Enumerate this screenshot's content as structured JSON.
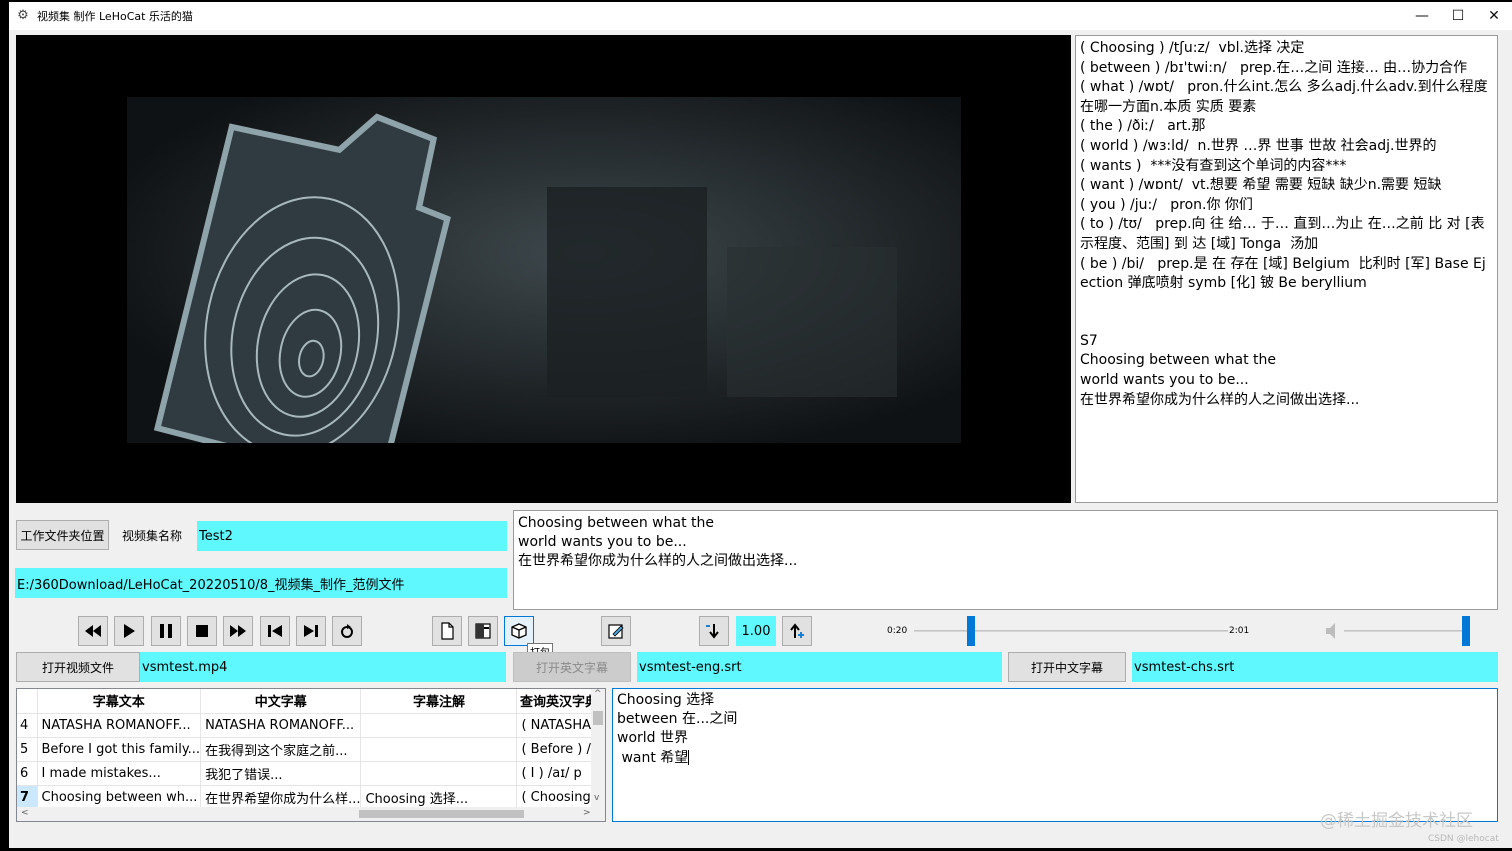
{
  "window": {
    "title": "视频集 制作  LeHoCat 乐活的猫",
    "minimize": "—",
    "maximize": "☐",
    "close": "✕"
  },
  "dictionary": {
    "lines": [
      "( Choosing ) /tʃu:z/  vbl.选择 决定",
      "( between ) /bɪ'twi:n/   prep.在…之间 连接… 由…协力合作",
      "( what ) /wɒt/   pron.什么int.怎么 多么adj.什么adv.到什么程度 在哪一方面n.本质 实质 要素",
      "( the ) /ðiː/   art.那",
      "( world ) /wɜ:ld/  n.世界 …界 世事 世故 社会adj.世界的",
      "( wants )  ***没有查到这个单词的内容***",
      "( want ) /wɒnt/  vt.想要 希望 需要 短缺 缺少n.需要 短缺",
      "( you ) /ju:/   pron.你 你们",
      "( to ) /tʊ/   prep.向 往 给… 于… 直到…为止 在…之前 比 对 [表示程度、范围] 到 达 [域] Tonga  汤加",
      "( be ) /bi/   prep.是 在 存在 [域] Belgium  比利时 [军] Base Ejection 弹底喷射 symb [化] 铍 Be beryllium"
    ],
    "entry_id": "S7",
    "entry_lines": [
      "Choosing between what the",
      "world wants you to be...",
      "在世界希望你成为什么样的人之间做出选择..."
    ]
  },
  "workspace": {
    "folder_button": "工作文件夹位置",
    "name_label": "视频集名称",
    "name_value": "Test2",
    "path_value": "E:/360Download/LeHoCat_20220510/8_视频集_制作_范例文件"
  },
  "current_subtitle": {
    "lines": [
      "Choosing between what the",
      "world wants you to be...",
      "在世界希望你成为什么样的人之间做出选择..."
    ]
  },
  "controls": {
    "speed": "1.00",
    "tooltip": "打包",
    "time_start": "0:20",
    "time_end": "2:01",
    "volume_level": 1.0,
    "position_fraction": 0.17
  },
  "files": {
    "open_video": "打开视频文件",
    "video_file": "vsmtest.mp4",
    "open_eng": "打开英文字幕",
    "eng_file": "vsmtest-eng.srt",
    "open_chs": "打开中文字幕",
    "chs_file": "vsmtest-chs.srt"
  },
  "table": {
    "headers": [
      "",
      "字幕文本",
      "中文字幕",
      "字幕注解",
      "查询英汉字典"
    ],
    "rows": [
      [
        "4",
        "NATASHA ROMANOFF...",
        "NATASHA ROMANOFF...",
        "",
        "( NATASHA"
      ],
      [
        "5",
        "Before I got this family...",
        "在我得到这个家庭之前...",
        "",
        "( Before ) /l"
      ],
      [
        "6",
        "I made mistakes...",
        "我犯了错误...",
        "",
        "( I ) /aɪ/  p"
      ],
      [
        "7",
        "Choosing between wh...",
        "在世界希望你成为什么样...",
        "Choosing 选择...",
        "( Choosing )"
      ]
    ]
  },
  "notes": {
    "lines": [
      "Choosing 选择",
      "between 在...之间",
      "world 世界",
      " want 希望"
    ]
  },
  "watermark": {
    "main": "@稀土掘金技术社区",
    "sub": "CSDN @lehocat"
  }
}
